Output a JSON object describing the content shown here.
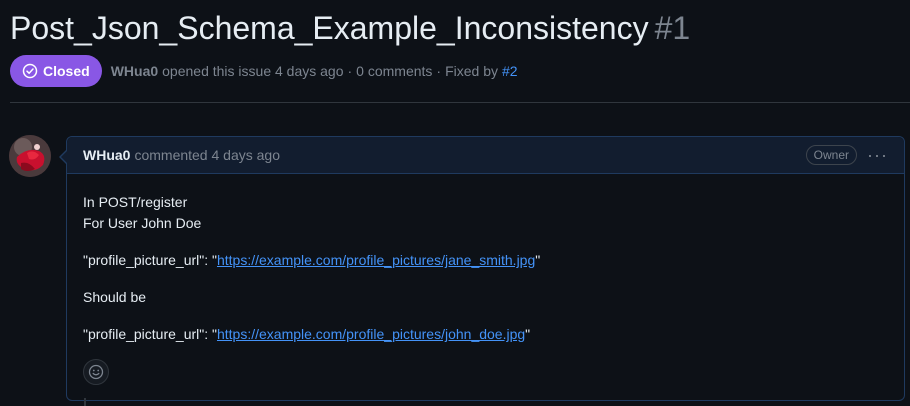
{
  "issue": {
    "title": "Post_Json_Schema_Example_Inconsistency",
    "number": "#1",
    "state": "Closed",
    "author": "WHua0",
    "opened_text": "opened this issue 4 days ago",
    "comments_text": "0 comments",
    "fixed_by_text": "Fixed by",
    "fixed_by_link": "#2",
    "separator": "·"
  },
  "comment": {
    "author": "WHua0",
    "action_text": "commented 4 days ago",
    "role_badge": "Owner",
    "more_label": "···",
    "line1": "In POST/register",
    "line2": "For User John Doe",
    "field_prefix": "\"profile_picture_url\": \"",
    "field_suffix": "\"",
    "url_wrong": "https://example.com/profile_pictures/jane_smith.jpg",
    "should_be": "Should be",
    "url_right": "https://example.com/profile_pictures/john_doe.jpg"
  },
  "icons": {
    "state": "check-circle-icon",
    "avatar": "avatar",
    "reaction": "smiley-icon"
  },
  "colors": {
    "closed_badge": "#8957e5",
    "link": "#4493f8",
    "background": "#0d1117",
    "comment_header": "#121d2f"
  }
}
